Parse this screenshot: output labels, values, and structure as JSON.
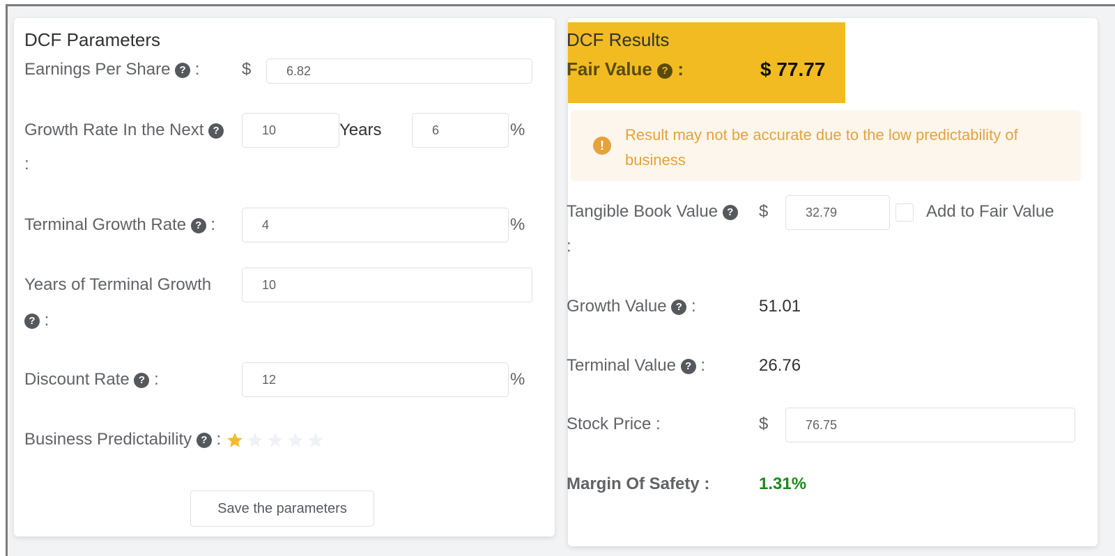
{
  "parameters": {
    "title": "DCF Parameters",
    "eps": {
      "label": "Earnings Per Share",
      "colon": ":",
      "currency": "$",
      "value": "6.82"
    },
    "growth": {
      "label": "Growth Rate In the Next",
      "colon": ":",
      "years_value": "10",
      "years_label": "Years",
      "rate_value": "6",
      "unit": "%"
    },
    "terminal_growth_rate": {
      "label": "Terminal Growth Rate",
      "colon": ":",
      "value": "4",
      "unit": "%"
    },
    "years_terminal": {
      "label": "Years of Terminal Growth",
      "colon": ":",
      "value": "10"
    },
    "discount_rate": {
      "label": "Discount Rate",
      "colon": ":",
      "value": "12",
      "unit": "%"
    },
    "predictability": {
      "label": "Business Predictability",
      "colon": ":",
      "rating": 1,
      "max_rating": 5
    },
    "save_label": "Save the parameters",
    "help_glyph": "?"
  },
  "results": {
    "title": "DCF Results",
    "fair_value_label": "Fair Value",
    "fair_value_colon": ":",
    "fair_value": "$ 77.77",
    "warning_text": "Result may not be accurate due to the low predictability of business",
    "warning_glyph": "!",
    "tangible_book": {
      "label": "Tangible Book Value",
      "colon": ":",
      "currency": "$",
      "value": "32.79",
      "checkbox_label": "Add to Fair Value",
      "checked": false
    },
    "growth_value": {
      "label": "Growth Value",
      "colon": ":",
      "value": "51.01"
    },
    "terminal_value": {
      "label": "Terminal Value",
      "colon": ":",
      "value": "26.76"
    },
    "stock_price": {
      "label": "Stock Price :",
      "currency": "$",
      "value": "76.75"
    },
    "margin_of_safety": {
      "label": "Margin Of Safety :",
      "value": "1.31%"
    }
  },
  "colors": {
    "accent": "#f2bb22",
    "warning": "#e6a23c",
    "positive": "#1a8a1a",
    "star_filled": "#f7ba2a",
    "star_empty": "#eff2f7"
  }
}
